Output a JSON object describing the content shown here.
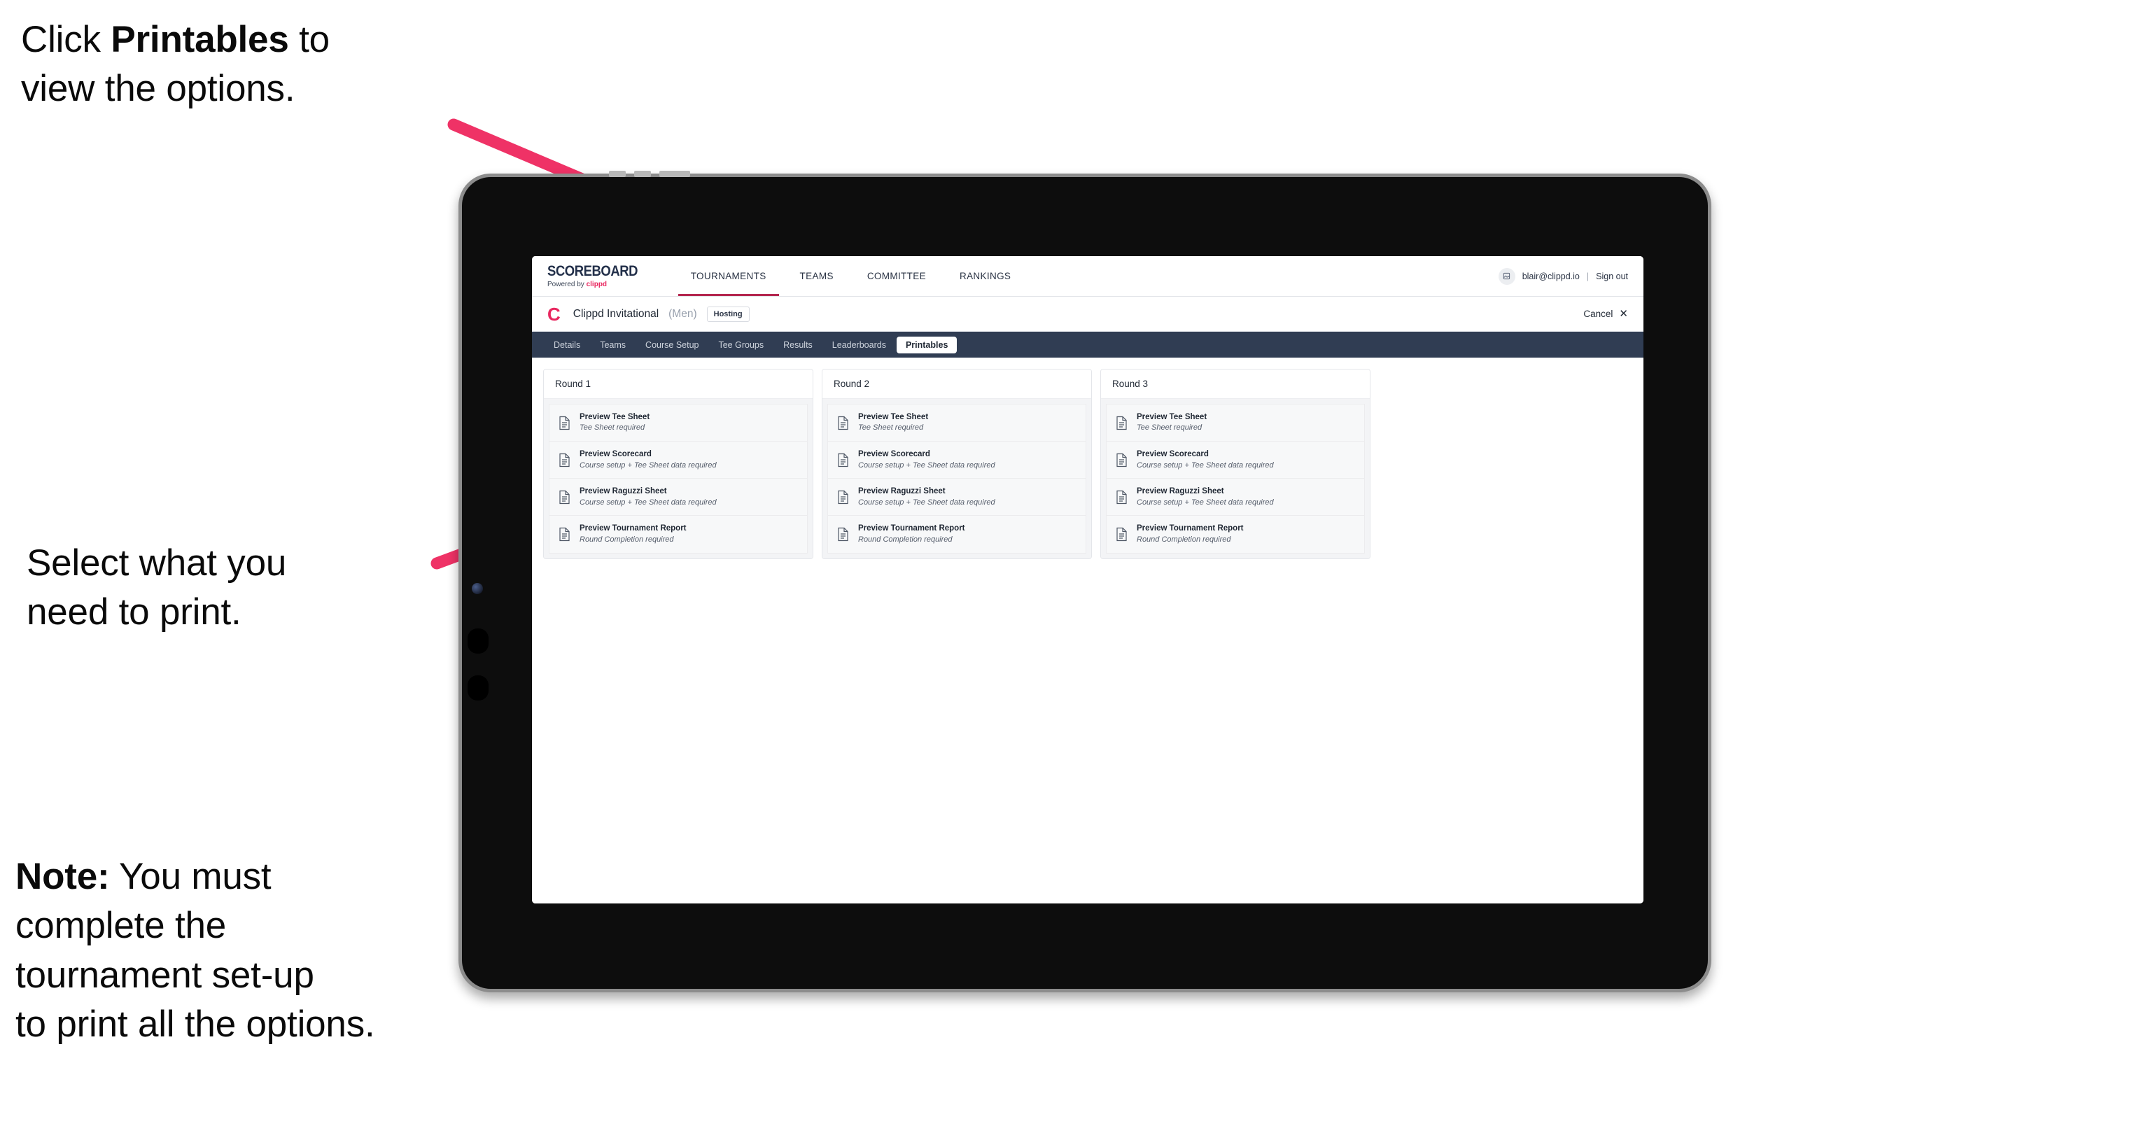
{
  "annotations": {
    "step1": "Click Printables to\nview the options.",
    "step1_prefix": "Click ",
    "step1_bold": "Printables",
    "step1_suffix": " to\nview the options.",
    "step2": "Select what you\n need to print.",
    "step3_bold": "Note:",
    "step3_rest": " You must\ncomplete the\ntournament set-up\nto print all the options."
  },
  "colors": {
    "arrow": "#ef3266",
    "brand_pink": "#e8275f",
    "nav_active_underline": "#b4264f",
    "subtab_bar": "#303d53",
    "tablet_body": "#0d0d0d",
    "tablet_edge": "#8c8c8c"
  },
  "app": {
    "brand": {
      "title": "SCOREBOARD",
      "sub_prefix": "Powered by ",
      "sub_brand": "clippd"
    },
    "nav": [
      {
        "label": "TOURNAMENTS",
        "active": true
      },
      {
        "label": "TEAMS",
        "active": false
      },
      {
        "label": "COMMITTEE",
        "active": false
      },
      {
        "label": "RANKINGS",
        "active": false
      }
    ],
    "account": {
      "avatar_icon": "user-avatar-icon",
      "email": "blair@clippd.io",
      "separator": "|",
      "sign_out": "Sign out"
    },
    "tournament": {
      "logo_letter": "C",
      "name": "Clippd Invitational",
      "gender": "(Men)",
      "status_badge": "Hosting",
      "cancel_label": "Cancel",
      "cancel_icon": "close-icon"
    },
    "subtabs": [
      {
        "label": "Details",
        "active": false
      },
      {
        "label": "Teams",
        "active": false
      },
      {
        "label": "Course Setup",
        "active": false
      },
      {
        "label": "Tee Groups",
        "active": false
      },
      {
        "label": "Results",
        "active": false
      },
      {
        "label": "Leaderboards",
        "active": false
      },
      {
        "label": "Printables",
        "active": true
      }
    ],
    "rounds": [
      {
        "title": "Round 1",
        "items": [
          {
            "title": "Preview Tee Sheet",
            "sub": "Tee Sheet required"
          },
          {
            "title": "Preview Scorecard",
            "sub": "Course setup + Tee Sheet data required"
          },
          {
            "title": "Preview Raguzzi Sheet",
            "sub": "Course setup + Tee Sheet data required"
          },
          {
            "title": "Preview Tournament Report",
            "sub": "Round Completion required"
          }
        ]
      },
      {
        "title": "Round 2",
        "items": [
          {
            "title": "Preview Tee Sheet",
            "sub": "Tee Sheet required"
          },
          {
            "title": "Preview Scorecard",
            "sub": "Course setup + Tee Sheet data required"
          },
          {
            "title": "Preview Raguzzi Sheet",
            "sub": "Course setup + Tee Sheet data required"
          },
          {
            "title": "Preview Tournament Report",
            "sub": "Round Completion required"
          }
        ]
      },
      {
        "title": "Round 3",
        "items": [
          {
            "title": "Preview Tee Sheet",
            "sub": "Tee Sheet required"
          },
          {
            "title": "Preview Scorecard",
            "sub": "Course setup + Tee Sheet data required"
          },
          {
            "title": "Preview Raguzzi Sheet",
            "sub": "Course setup + Tee Sheet data required"
          },
          {
            "title": "Preview Tournament Report",
            "sub": "Round Completion required"
          }
        ]
      }
    ]
  }
}
